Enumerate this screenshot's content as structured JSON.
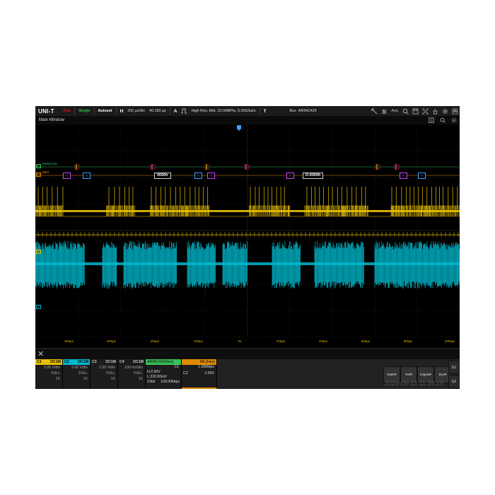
{
  "topbar": {
    "logo": "UNI-T",
    "run_state": "Run",
    "single": "Single",
    "autoset": "Autoset",
    "h_badge": "H",
    "timebase": "200 µs/div",
    "delay": "40.180 µs",
    "a_badge": "A",
    "acq_info": "High Res, 8bit, 10.00MPts, 5.00GSa/s",
    "t_badge": "T",
    "bus_label": "Bus",
    "bus_protocol": "ARINC429",
    "acq_icon_label": "Acq"
  },
  "main_window": {
    "title": "Main Window"
  },
  "waveform": {
    "bus1_label": "ARINC429",
    "bus2_label": "1553",
    "decode_values": [
      "0000h",
      "D:0000h"
    ],
    "small_box_text": "...",
    "x_ticks": [
      "-800µs",
      "-600µs",
      "-400µs",
      "-200µs",
      "0s",
      "200µs",
      "400µs",
      "600µs",
      "800µs",
      "1000µs"
    ],
    "colors": {
      "ch1": "#e8c000",
      "ch2": "#00b8cc",
      "bus": "#39a0ff",
      "purple": "#cc44ff",
      "red": "#e02020",
      "grid": "#3a3a3a"
    }
  },
  "channels": [
    {
      "name": "C1",
      "coupling": "DC1M",
      "scale": "2.00 V/div",
      "bw": "FULL",
      "probe": "1X",
      "color": "#e8c000"
    },
    {
      "name": "C2",
      "coupling": "DC1M",
      "scale": "2.00 V/div",
      "bw": "FULL",
      "probe": "1X",
      "color": "#00b8cc"
    },
    {
      "name": "C3",
      "coupling": "DC1M",
      "scale": "2.00 V/div",
      "bw": "FULL",
      "probe": "1X",
      "color": "#1c1c1c"
    },
    {
      "name": "C4",
      "coupling": "DC1M",
      "scale": "100 mV/div",
      "bw": "FULL",
      "probe": "1X",
      "color": "#1c1c1c"
    }
  ],
  "bus1": {
    "title": "ARINC429(Hex)",
    "source": "C1",
    "h": "H:2.50V",
    "l": "L:220.00mV",
    "rate_left": "19bit",
    "rate_right": "100.00kbps"
  },
  "bus2": {
    "title": "MIL(Hex)",
    "rate": "1.00Mbps",
    "src": "C2",
    "level": "2.50V"
  },
  "buttons": {
    "math": "Math▾",
    "ref": "Ref▾",
    "digital": "Digital▾",
    "bus": "Bus▾",
    "g1": "G1",
    "g2": "G2"
  },
  "datetime": "2024-09-23 11:39:19"
}
